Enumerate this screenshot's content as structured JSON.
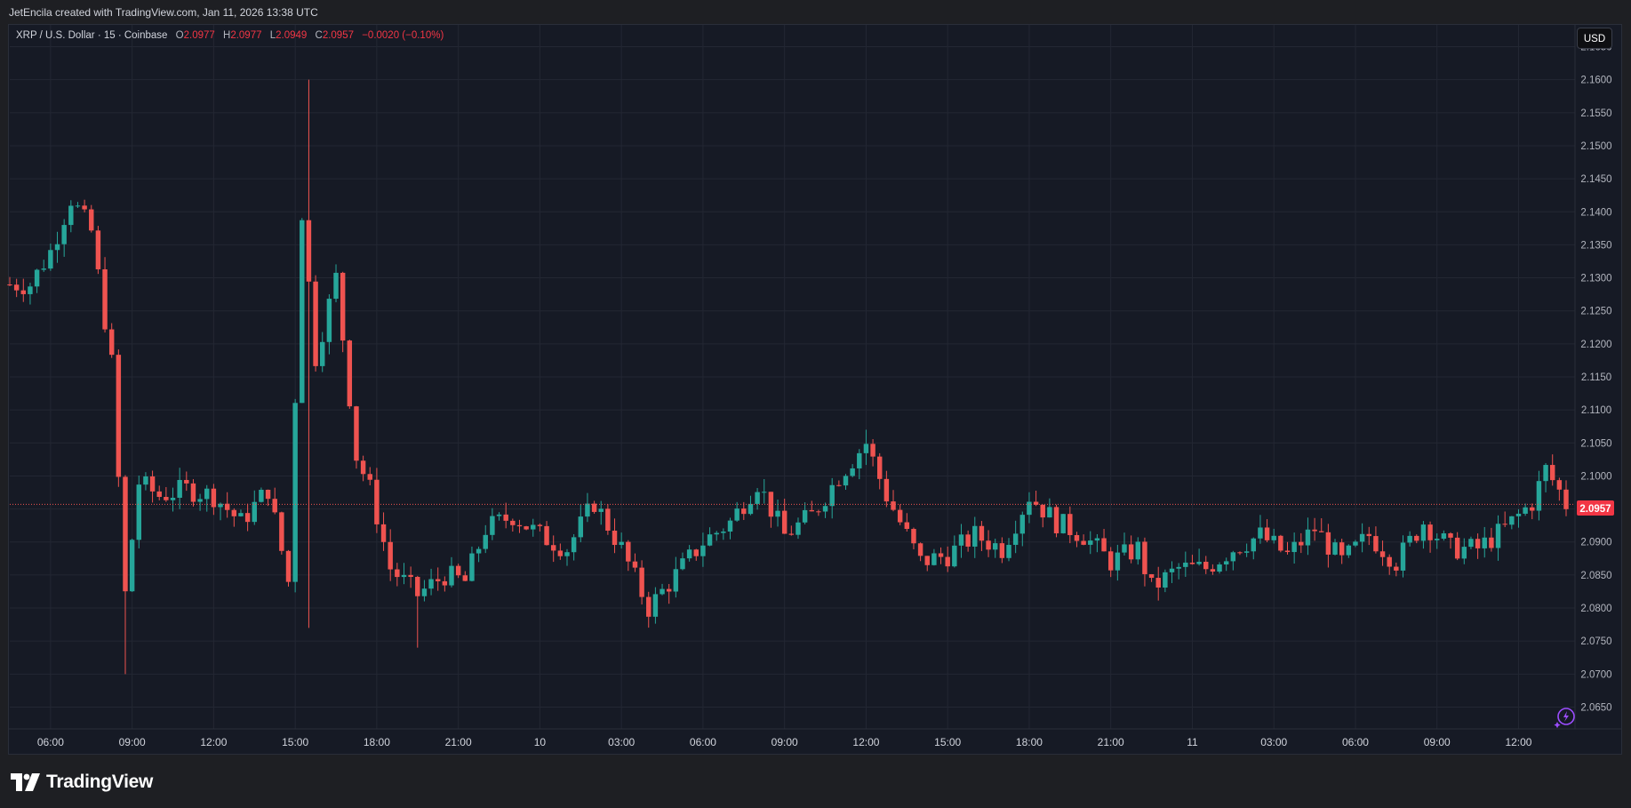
{
  "header": {
    "credit": "JetEncila created with TradingView.com, Jan 11, 2026 13:38 UTC"
  },
  "legend": {
    "symbol": "XRP / U.S. Dollar · 15 · Coinbase",
    "o_label": "O",
    "o_value": "2.0977",
    "h_label": "H",
    "h_value": "2.0977",
    "l_label": "L",
    "l_value": "2.0949",
    "c_label": "C",
    "c_value": "2.0957",
    "change": "−0.0020 (−0.10%)"
  },
  "currency_button": "USD",
  "brand": {
    "name": "TradingView"
  },
  "icons": {
    "logo": "tradingview-logo-icon",
    "snapshot": "snapshot-icon"
  },
  "colors": {
    "up": "#26a69a",
    "down": "#ef5350",
    "background": "#161a25",
    "grid": "#232733",
    "last_price_line": "#ef5350"
  },
  "chart_data": {
    "type": "candlestick",
    "interval_minutes": 15,
    "y_ticks": [
      "2.1650",
      "2.1600",
      "2.1550",
      "2.1500",
      "2.1450",
      "2.1400",
      "2.1350",
      "2.1300",
      "2.1250",
      "2.1200",
      "2.1150",
      "2.1100",
      "2.1050",
      "2.1000",
      "2.0950",
      "2.0900",
      "2.0850",
      "2.0800",
      "2.0750",
      "2.0700",
      "2.0650"
    ],
    "x_ticks": [
      "06:00",
      "09:00",
      "12:00",
      "15:00",
      "18:00",
      "21:00",
      "10",
      "03:00",
      "06:00",
      "09:00",
      "12:00",
      "15:00",
      "18:00",
      "21:00",
      "11",
      "03:00",
      "06:00",
      "09:00",
      "12:00"
    ],
    "ylim": [
      2.0617,
      2.1683
    ],
    "last_price": "2.0957",
    "grid": true,
    "key_points": [
      {
        "time": "Jan 9 05:15",
        "close": 2.129
      },
      {
        "time": "Jan 9 06:45",
        "high": 2.145,
        "close": 2.142
      },
      {
        "time": "Jan 9 08:45",
        "low": 2.07,
        "close": 2.082
      },
      {
        "time": "Jan 9 15:30",
        "high": 2.16,
        "low": 2.077
      },
      {
        "time": "Jan 9 19:30",
        "low": 2.074,
        "close": 2.082
      },
      {
        "time": "Jan 10 04:00",
        "low": 2.078,
        "close": 2.08
      },
      {
        "time": "Jan 10 12:00",
        "high": 2.107,
        "close": 2.105
      },
      {
        "time": "Jan 10 22:30",
        "low": 2.081,
        "close": 2.083
      },
      {
        "time": "Jan 11 13:00",
        "high": 2.104,
        "close": 2.101
      },
      {
        "time": "Jan 11 13:30",
        "open": 2.0977,
        "high": 2.0977,
        "low": 2.0949,
        "close": 2.0957
      }
    ]
  }
}
